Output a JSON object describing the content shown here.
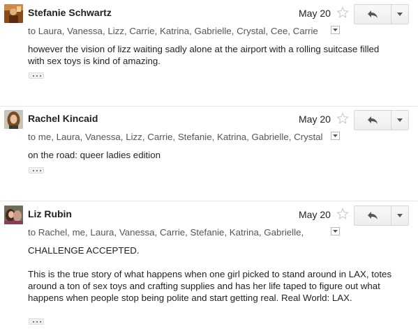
{
  "messages": [
    {
      "sender": "Stefanie Schwartz",
      "date": "May 20",
      "recipients": "to Laura, Vanessa, Lizz, Carrie, Katrina, Gabrielle, Crystal, Cee, Carrie",
      "body": [
        "however the vision of lizz waiting sadly alone at the airport with a rolling suitcase filled with sex toys is kind of amazing."
      ]
    },
    {
      "sender": "Rachel Kincaid",
      "date": "May 20",
      "recipients": "to me, Laura, Vanessa, Lizz, Carrie, Stefanie, Katrina, Gabrielle, Crystal",
      "body": [
        "on the road: queer ladies edition"
      ]
    },
    {
      "sender": "Liz Rubin",
      "date": "May 20",
      "recipients": "to Rachel, me, Laura, Vanessa, Carrie, Stefanie, Katrina, Gabrielle,",
      "body": [
        "CHALLENGE ACCEPTED.",
        "This is the true story of what happens when one girl picked to stand around in LAX, totes around a ton of sex toys and crafting supplies and has her life taped to figure out what happens when people stop being polite and start getting real. Real World: LAX."
      ]
    }
  ],
  "icons": {
    "star": "star-outline-icon",
    "reply": "reply-arrow-icon",
    "more": "chevron-down-icon",
    "details": "small-caret-down-icon",
    "quoted": "ellipsis-icon"
  },
  "colors": {
    "text": "#222222",
    "recipients": "#555555",
    "divider": "#e5e5e5",
    "button_border": "#d8d8d8"
  }
}
